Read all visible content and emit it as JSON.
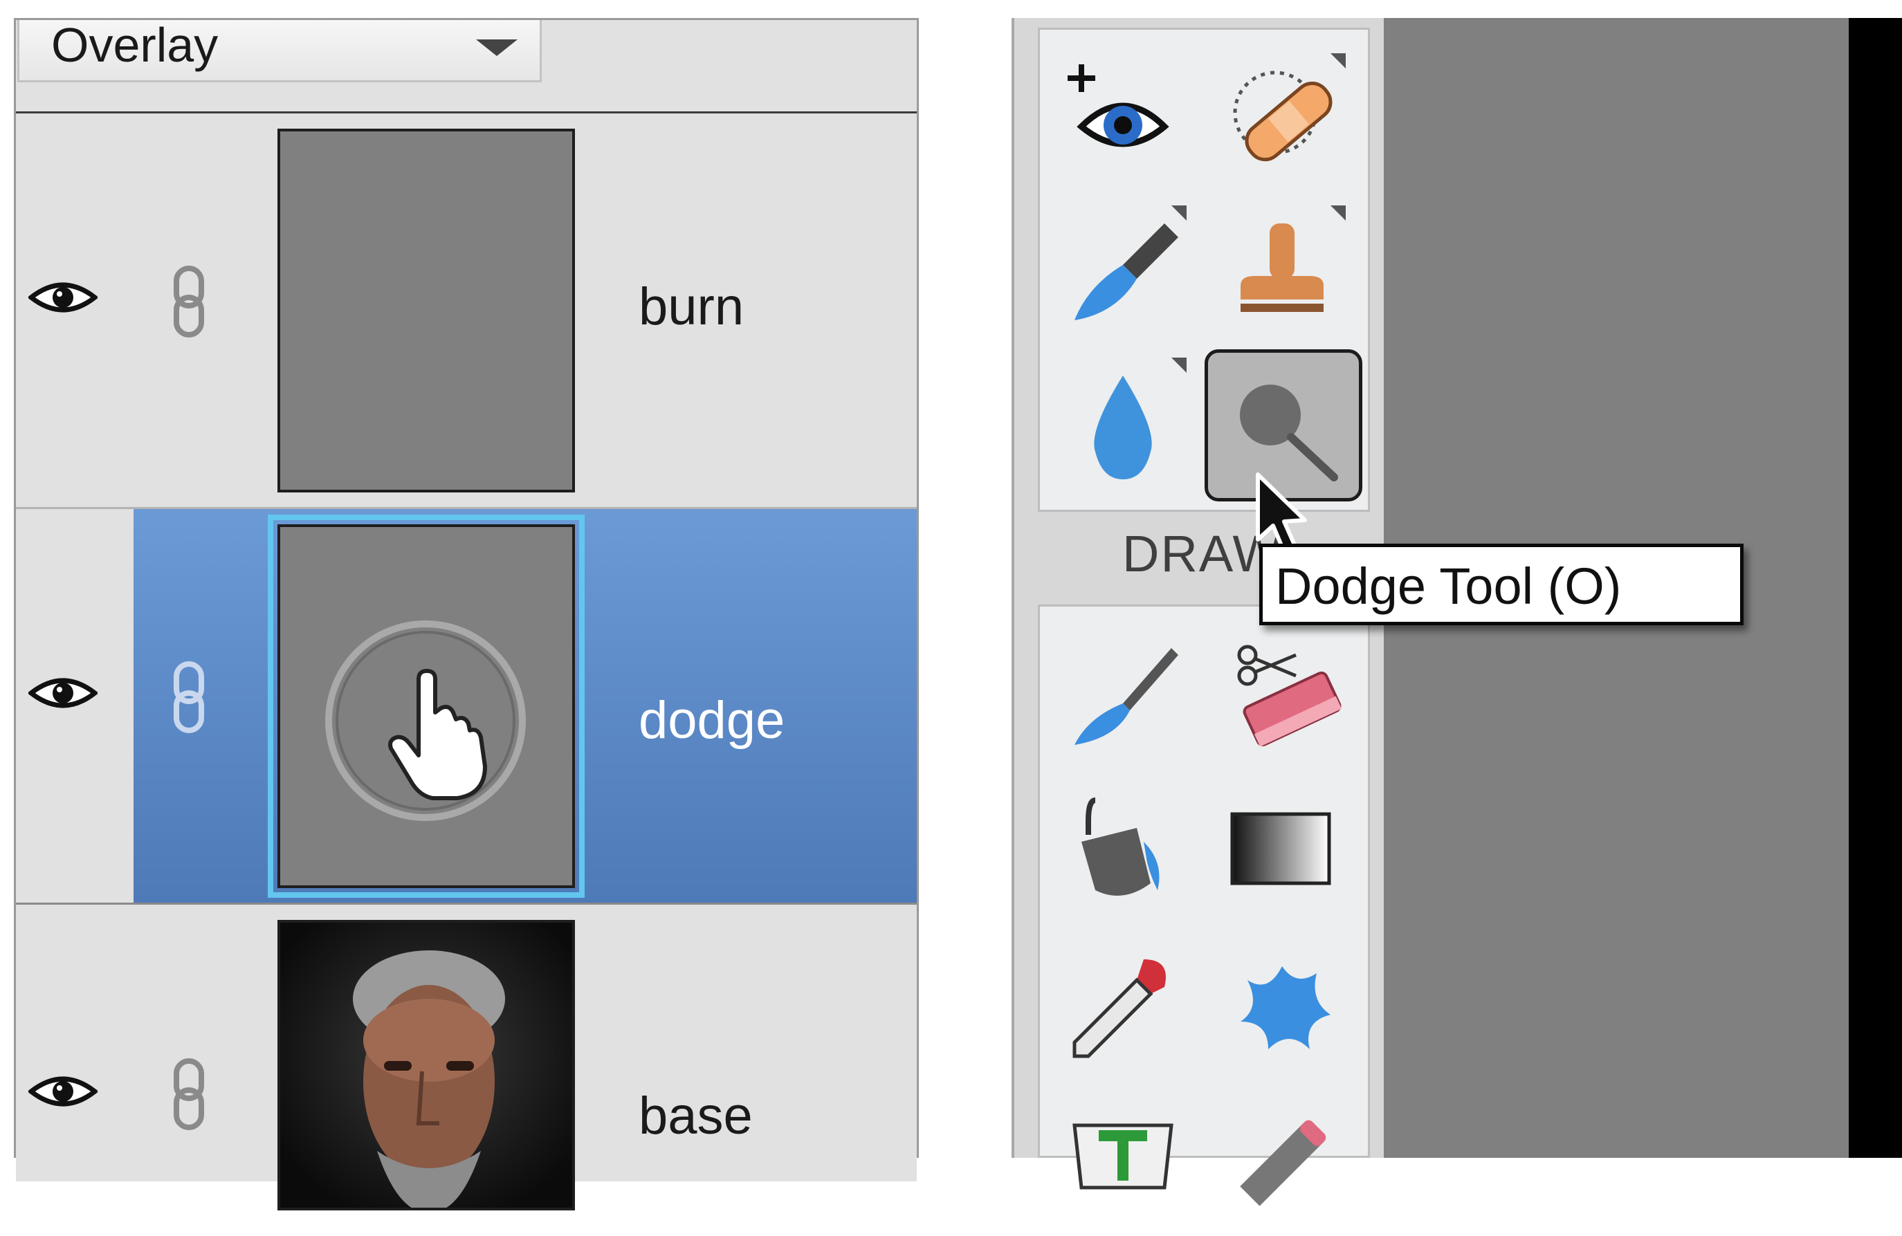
{
  "layers_panel": {
    "blend_mode": "Overlay",
    "layers": [
      {
        "name": "burn",
        "visible": true,
        "selected": false
      },
      {
        "name": "dodge",
        "visible": true,
        "selected": true
      },
      {
        "name": "base",
        "visible": true,
        "selected": false
      }
    ]
  },
  "tool_panel": {
    "group_label": "DRAW",
    "enhance_tools": [
      "eye-plus-icon",
      "bandage-icon",
      "brush-blue-icon",
      "clone-stamp-icon",
      "blur-drop-icon",
      "dodge-tool-icon"
    ],
    "draw_tools": [
      "paint-brush-icon",
      "eraser-icon",
      "paint-bucket-icon",
      "gradient-icon",
      "eyedropper-icon",
      "custom-shape-icon",
      "type-tool-icon",
      "pencil-icon"
    ],
    "active_tool": "dodge"
  },
  "tooltip": {
    "text": "Dodge Tool (O)"
  },
  "colors": {
    "selection": "#5a88c6",
    "thumb_highlight": "#62c6ef",
    "canvas": "#808080"
  }
}
